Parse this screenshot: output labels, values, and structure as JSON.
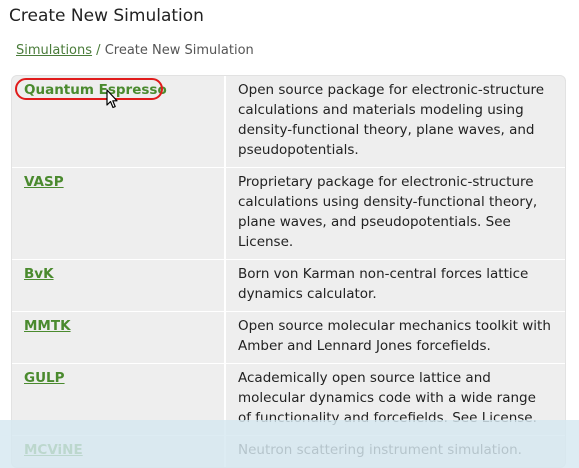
{
  "page": {
    "title": "Create New Simulation"
  },
  "breadcrumb": {
    "link": "Simulations",
    "separator": "/",
    "current": "Create New Simulation"
  },
  "simulations": [
    {
      "name": "Quantum Espresso",
      "description": "Open source package for electronic-structure calculations and materials modeling using density-functional theory, plane waves, and pseudopotentials."
    },
    {
      "name": "VASP",
      "description": "Proprietary package for electronic-structure calculations using density-functional theory, plane waves, and pseudopotentials. See License."
    },
    {
      "name": "BvK",
      "description": "Born von Karman non-central forces lattice dynamics calculator."
    },
    {
      "name": "MMTK",
      "description": "Open source molecular mechanics toolkit with Amber and Lennard Jones forcefields."
    },
    {
      "name": "GULP",
      "description": "Academically open source lattice and molecular dynamics code with a wide range of functionality and forcefields. See License."
    },
    {
      "name": "MCViNE",
      "description": "Neutron scattering instrument simulation."
    }
  ],
  "colors": {
    "link": "#4a8a2e",
    "highlight_circle": "#e01b1b",
    "table_bg": "#eeeeee",
    "overlay": "#d6e8f0"
  },
  "icons": {
    "cursor": "mouse-pointer-icon"
  }
}
